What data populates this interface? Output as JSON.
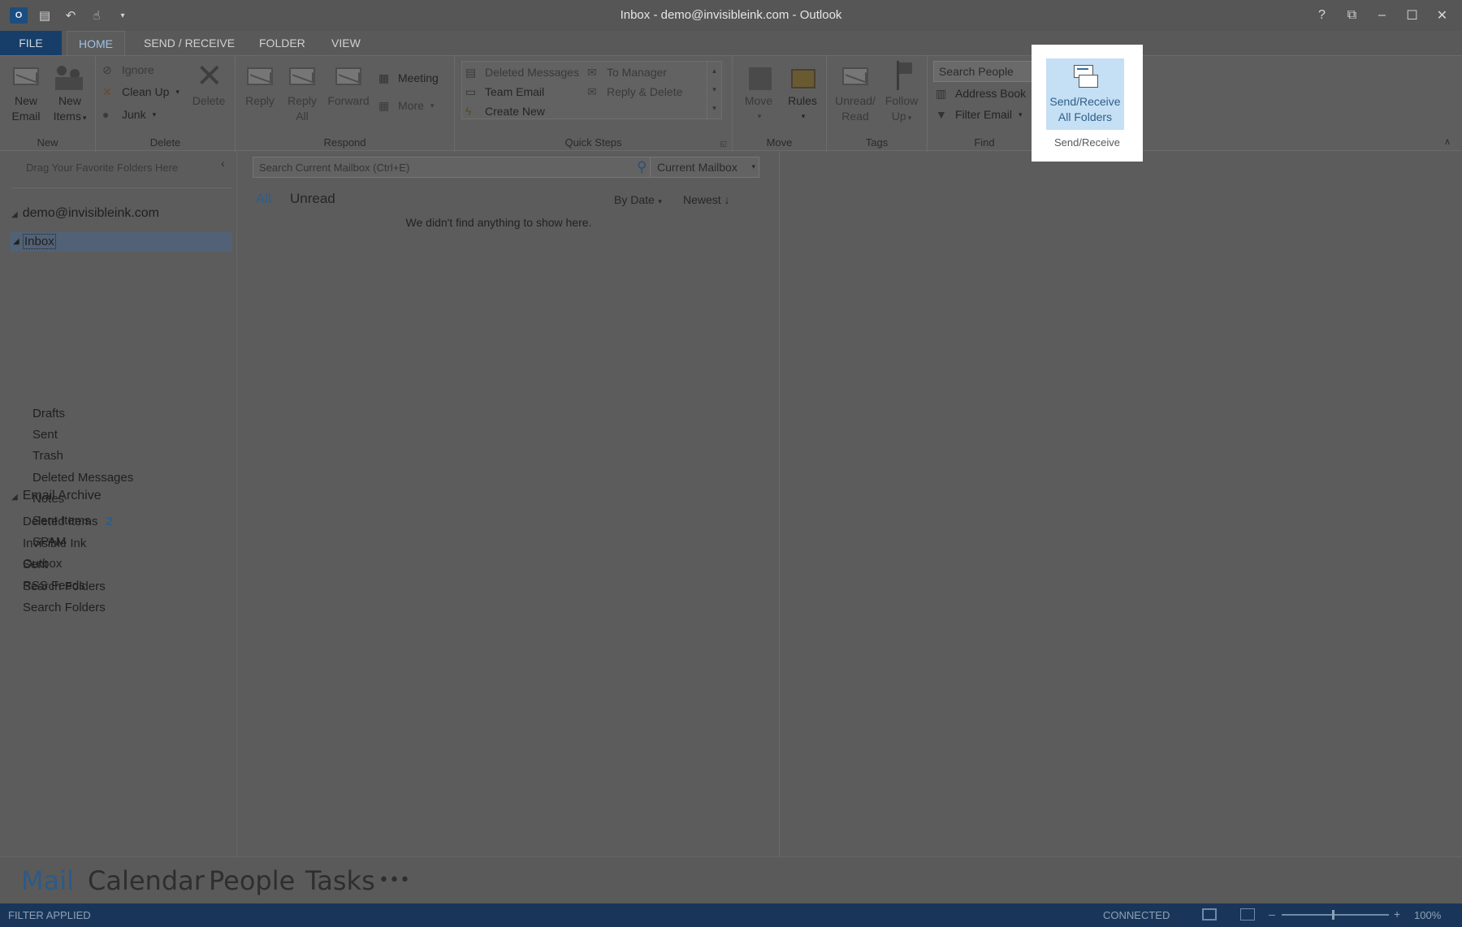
{
  "window": {
    "title": "Inbox - demo@invisibleink.com - Outlook",
    "controls": [
      "?",
      "⧉",
      "–",
      "☐",
      "✕"
    ]
  },
  "tabs": [
    "FILE",
    "HOME",
    "SEND / RECEIVE",
    "FOLDER",
    "VIEW"
  ],
  "ribbon": {
    "new": {
      "label": "New",
      "new_email": [
        "New",
        "Email"
      ],
      "new_items": [
        "New",
        "Items"
      ]
    },
    "delete": {
      "label": "Delete",
      "ignore": "Ignore",
      "clean_up": "Clean Up",
      "junk": "Junk",
      "delete": "Delete"
    },
    "respond": {
      "label": "Respond",
      "reply": "Reply",
      "reply_all": [
        "Reply",
        "All"
      ],
      "forward": "Forward",
      "meeting": "Meeting",
      "more": "More"
    },
    "quick_steps": {
      "label": "Quick Steps",
      "items": [
        "Deleted Messages",
        "To Manager",
        "Team Email",
        "Reply & Delete",
        "Create New"
      ]
    },
    "move": {
      "label": "Move",
      "move": "Move",
      "rules": "Rules"
    },
    "tags": {
      "label": "Tags",
      "unread_read": [
        "Unread/",
        "Read"
      ],
      "follow_up": [
        "Follow",
        "Up"
      ]
    },
    "find": {
      "label": "Find",
      "search_people": "Search People",
      "address_book": "Address Book",
      "filter_email": "Filter Email"
    },
    "send_receive": {
      "label": "Send/Receive",
      "button": [
        "Send/Receive",
        "All Folders"
      ]
    }
  },
  "folder_pane": {
    "favorites_hint": "Drag Your Favorite Folders Here",
    "account1": {
      "name": "demo@invisibleink.com",
      "folders": [
        "Inbox",
        "Drafts",
        "Sent",
        "Trash",
        "Deleted Messages",
        "Notes",
        "Sent Items",
        "SPAM",
        "Outbox",
        "RSS Feeds",
        "Search Folders"
      ]
    },
    "account2": {
      "name": "Email Archive",
      "folders": [
        {
          "name": "Deleted Items",
          "count": "2"
        },
        {
          "name": "Invisible Ink",
          "count": ""
        },
        {
          "name": "Sent",
          "count": ""
        },
        {
          "name": "Search Folders",
          "count": ""
        }
      ]
    }
  },
  "message_list": {
    "search_placeholder": "Search Current Mailbox (Ctrl+E)",
    "scope": "Current Mailbox",
    "filters": [
      "All",
      "Unread"
    ],
    "sort_by": "By Date",
    "order": "Newest",
    "empty_text": "We didn't find anything to show here."
  },
  "nav": [
    "Mail",
    "Calendar",
    "People",
    "Tasks",
    "•••"
  ],
  "status": {
    "left": "FILTER APPLIED",
    "connection": "CONNECTED",
    "zoom": "100%"
  },
  "colors": {
    "highlight": "#ffffff",
    "send_receive_button": "#c5dff4",
    "statusbar": "#19365a",
    "accent": "#2c5a88"
  }
}
